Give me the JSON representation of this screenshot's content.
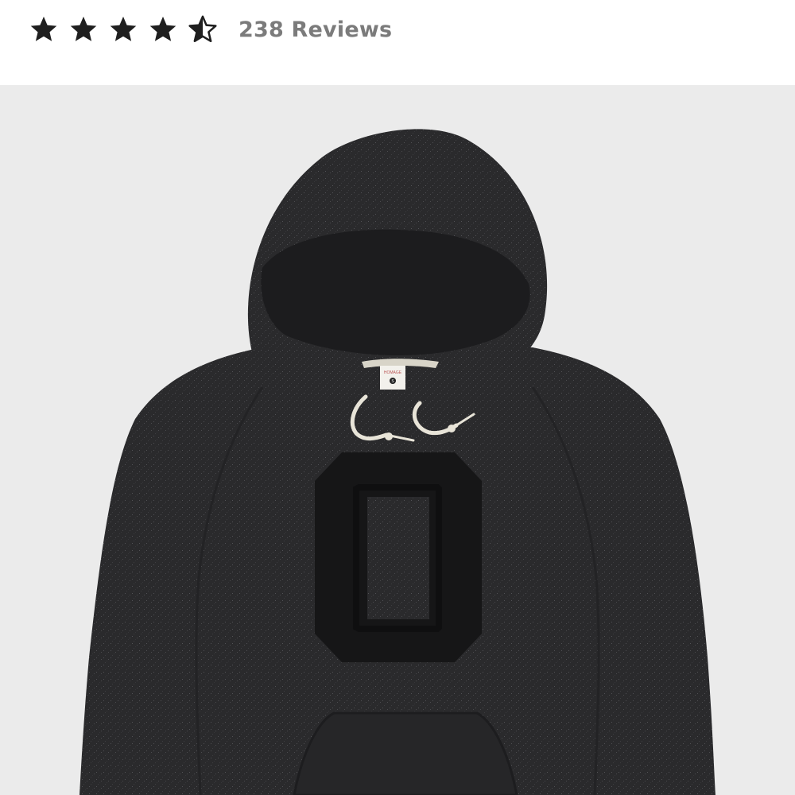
{
  "rating": {
    "value": 4.5,
    "max": 5,
    "star_color": "#1f1f1f",
    "count_text": "238 Reviews"
  },
  "product": {
    "image_icon": "hoodie-product-photo",
    "background_color": "#ebebeb",
    "garment_color": "#2a2a2c",
    "tag_brand": "HOMAGE",
    "tag_size": "S"
  }
}
